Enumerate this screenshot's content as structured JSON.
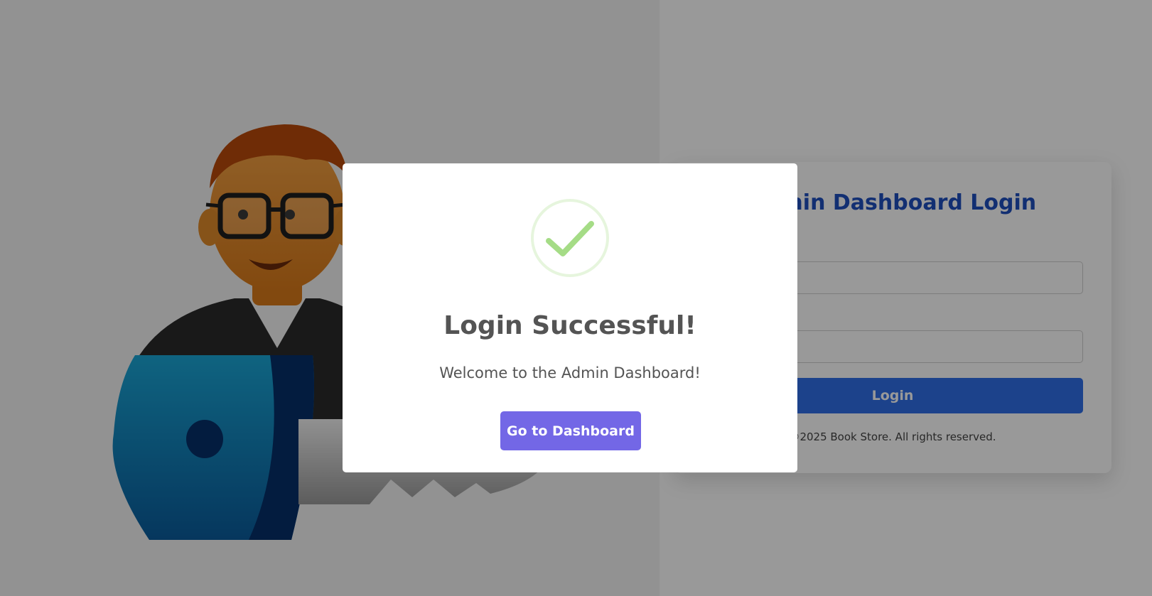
{
  "login_card": {
    "title": "Admin Dashboard Login",
    "login_button": "Login",
    "footer": "©2025 Book Store. All rights reserved."
  },
  "modal": {
    "icon": "success-check-icon",
    "title": "Login Successful!",
    "message": "Welcome to the Admin Dashboard!",
    "button": "Go to Dashboard"
  },
  "colors": {
    "primary_blue": "#2f6fe8",
    "title_blue": "#1f4fbf",
    "modal_button": "#7367e6",
    "success_green": "#a5dc86"
  }
}
